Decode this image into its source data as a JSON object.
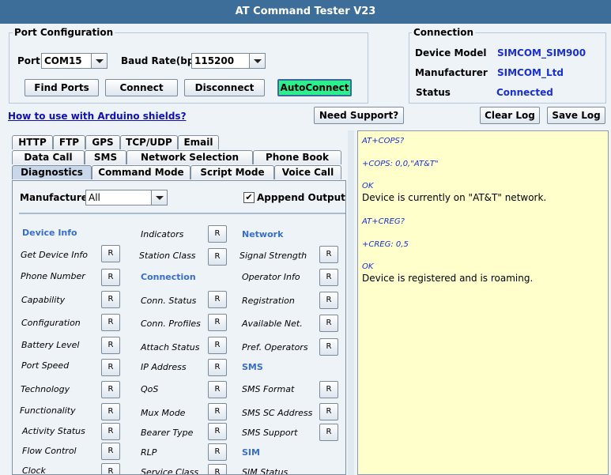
{
  "window": {
    "title": "AT Command Tester V23"
  },
  "port_config": {
    "title": "Port Configuration",
    "port_label": "Port",
    "port_value": "COM15",
    "baud_label": "Baud Rate(bps)",
    "baud_value": "115200",
    "buttons": {
      "find_ports": "Find Ports",
      "connect": "Connect",
      "disconnect": "Disconnect",
      "autoconnect": "AutoConnect"
    }
  },
  "connection": {
    "title": "Connection",
    "device_model_label": "Device Model",
    "device_model_value": "SIMCOM_SIM900",
    "manufacturer_label": "Manufacturer",
    "manufacturer_value": "SIMCOM_Ltd",
    "status_label": "Status",
    "status_value": "Connected"
  },
  "links": {
    "arduino": "How to use with Arduino shields?"
  },
  "buttons": {
    "need_support": "Need Support?",
    "clear_log": "Clear Log",
    "save_log": "Save Log"
  },
  "tabs": {
    "row1": [
      "HTTP",
      "FTP",
      "GPS",
      "TCP/UDP",
      "Email"
    ],
    "row2": [
      "Data Call",
      "SMS",
      "Network Selection",
      "Phone Book"
    ],
    "row3": [
      "Diagnostics",
      "Command Mode",
      "Script Mode",
      "Voice Call"
    ],
    "active": "Diagnostics"
  },
  "diagnostics": {
    "manufacturer_label": "Manufacturer",
    "manufacturer_value": "All",
    "append_output_label": "Apppend Output",
    "append_output_checked": true,
    "r_label": "R",
    "col1": {
      "header": "Device Info",
      "items": [
        "Get Device Info",
        "Phone Number",
        "Capability",
        "Configuration",
        "Battery Level",
        "Port Speed",
        "Technology",
        "Functionality",
        "Activity Status",
        "Flow Control",
        "Clock"
      ]
    },
    "col2": {
      "items_top": [
        "Indicators",
        "Station Class"
      ],
      "header": "Connection",
      "items": [
        "Conn. Status",
        "Conn. Profiles",
        "Attach Status",
        "IP Address",
        "QoS",
        "Mux Mode",
        "Bearer Type",
        "RLP",
        "Service Class"
      ]
    },
    "col3": {
      "header": "Network",
      "items": [
        "Signal Strength",
        "Operator Info",
        "Registration",
        "Available Net.",
        "Pref. Operators"
      ],
      "header_sms": "SMS",
      "sms_items": [
        "SMS Format",
        "SMS SC Address",
        "SMS Support"
      ],
      "header_sim": "SIM",
      "sim_items": [
        "SIM Status"
      ]
    }
  },
  "log": [
    {
      "type": "cmd",
      "text": "AT+COPS?"
    },
    {
      "type": "cmd",
      "text": "+COPS: 0,0,\"AT&T\""
    },
    {
      "type": "cmd",
      "text": "OK"
    },
    {
      "type": "msg",
      "text": "Device is currently on \"AT&T\" network."
    },
    {
      "type": "cmd",
      "text": "AT+CREG?"
    },
    {
      "type": "cmd",
      "text": "+CREG: 0,5"
    },
    {
      "type": "cmd",
      "text": "OK"
    },
    {
      "type": "msg",
      "text": "Device is registered and is roaming."
    }
  ],
  "colors": {
    "titlebar": "#3d6d99",
    "autoconnect": "#2cf08e",
    "log_background": "#ffffcc",
    "value_blue": "#1a2fd0"
  }
}
